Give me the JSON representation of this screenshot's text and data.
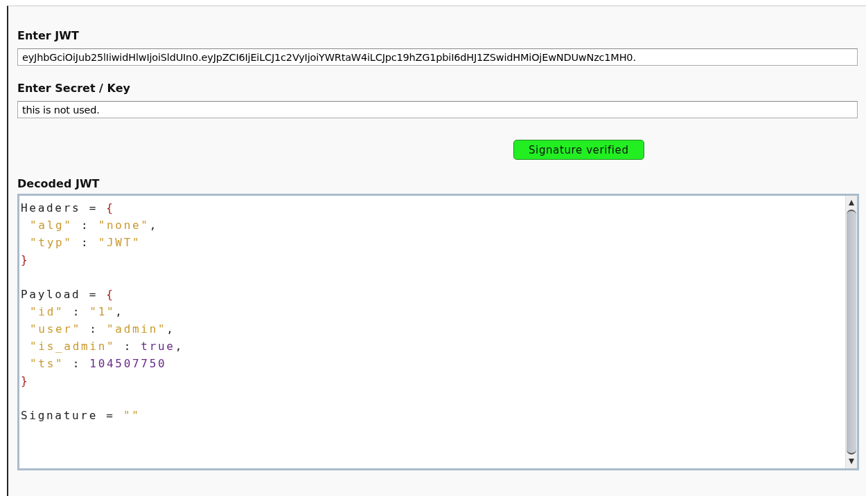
{
  "fields": [
    {
      "label": "Enter JWT",
      "value": "eyJhbGciOiJub25lIiwidHlwIjoiSldUIn0.eyJpZCI6IjEiLCJ1c2VyIjoiYWRtaW4iLCJpc19hZG1pbiI6dHJ1ZSwidHMiOjEwNDUwNzc1MH0."
    },
    {
      "label": "Enter Secret / Key",
      "value": "this is not used."
    }
  ],
  "status_button": {
    "label": "Signature verified",
    "verified": true
  },
  "decoded": {
    "label": "Decoded JWT",
    "sections": [
      {
        "name": "Headers",
        "op": "=",
        "open": "{",
        "close": "}",
        "entries": [
          {
            "key": "\"alg\"",
            "sep": ":",
            "value": "\"none\"",
            "kind": "string",
            "punct": ","
          },
          {
            "key": "\"typ\"",
            "sep": ":",
            "value": "\"JWT\"",
            "kind": "string"
          }
        ]
      },
      {
        "name": "Payload",
        "op": "=",
        "open": "{",
        "close": "}",
        "entries": [
          {
            "key": "\"id\"",
            "sep": ":",
            "value": "\"1\"",
            "kind": "string",
            "punct": ","
          },
          {
            "key": "\"user\"",
            "sep": ":",
            "value": "\"admin\"",
            "kind": "string",
            "punct": ","
          },
          {
            "key": "\"is_admin\"",
            "sep": ":",
            "value": "true",
            "kind": "literal",
            "punct": ","
          },
          {
            "key": "\"ts\"",
            "sep": ":",
            "value": "104507750",
            "kind": "literal"
          }
        ]
      },
      {
        "name": "Signature",
        "op": "=",
        "value": "\"\"",
        "kind": "string"
      }
    ]
  }
}
